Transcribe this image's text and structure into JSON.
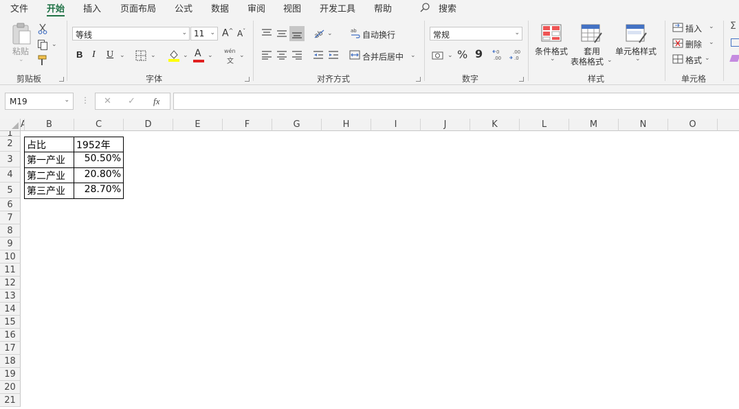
{
  "menu": {
    "tabs": [
      "文件",
      "开始",
      "插入",
      "页面布局",
      "公式",
      "数据",
      "审阅",
      "视图",
      "开发工具",
      "帮助"
    ],
    "search_label": "搜索"
  },
  "ribbon": {
    "clipboard": {
      "paste_label": "粘贴",
      "group_label": "剪贴板"
    },
    "font": {
      "font_name": "等线",
      "font_size": "11",
      "bold": "B",
      "italic": "I",
      "underline": "U",
      "phonetic": "wén",
      "phonetic_sub": "文",
      "group_label": "字体",
      "grow": "A",
      "shrink": "A",
      "font_color_glyph": "A"
    },
    "alignment": {
      "wrap_label": "自动换行",
      "merge_label": "合并后居中",
      "group_label": "对齐方式"
    },
    "number": {
      "format": "常规",
      "percent": "%",
      "comma": "9",
      "group_label": "数字"
    },
    "styles": {
      "conditional_label": "条件格式",
      "table_label_1": "套用",
      "table_label_2": "表格格式",
      "cell_styles_label": "单元格样式",
      "group_label": "样式"
    },
    "cells": {
      "insert_label": "插入",
      "delete_label": "删除",
      "format_label": "格式",
      "group_label": "单元格"
    }
  },
  "formula_bar": {
    "name_box": "M19",
    "fx": "fx",
    "cancel": "✕",
    "enter": "✓"
  },
  "grid": {
    "columns": [
      "A",
      "B",
      "C",
      "D",
      "E",
      "F",
      "G",
      "H",
      "I",
      "J",
      "K",
      "L",
      "M",
      "N",
      "O"
    ],
    "rows": [
      "1",
      "2",
      "3",
      "4",
      "5",
      "6",
      "7",
      "8",
      "9",
      "10",
      "11",
      "12",
      "13",
      "14",
      "15",
      "16",
      "17",
      "18",
      "19",
      "20",
      "21"
    ]
  },
  "table": {
    "header": [
      "占比",
      "1952年"
    ],
    "rows": [
      [
        "第一产业",
        "50.50%"
      ],
      [
        "第二产业",
        "20.80%"
      ],
      [
        "第三产业",
        "28.70%"
      ]
    ]
  },
  "colors": {
    "accent": "#217346",
    "font_color": "#e02020",
    "highlight": "#ffff00"
  }
}
